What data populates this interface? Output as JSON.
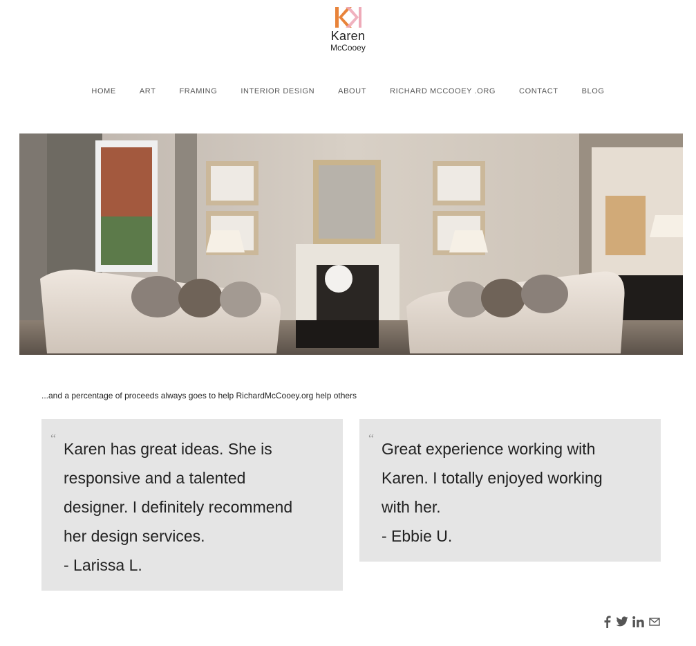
{
  "brand": {
    "name": "Karen",
    "subname": "McCooey",
    "colors": {
      "orange": "#e8833a",
      "pink": "#eeaab8"
    }
  },
  "nav": {
    "items": [
      {
        "label": "HOME"
      },
      {
        "label": "ART"
      },
      {
        "label": "FRAMING"
      },
      {
        "label": "INTERIOR DESIGN"
      },
      {
        "label": "ABOUT"
      },
      {
        "label": "RICHARD MCCOOEY .ORG"
      },
      {
        "label": "CONTACT"
      },
      {
        "label": "BLOG"
      }
    ]
  },
  "hero": {
    "image": "living-room-interior-photo"
  },
  "tagline": "...and a percentage of proceeds always goes to help RichardMcCooey.org help others",
  "testimonials": [
    {
      "text": "Karen has great ideas. She is\nresponsive and a talented\ndesigner. I definitely recommend\nher design services.\n- Larissa L."
    },
    {
      "text": "Great experience working with\nKaren. I totally enjoyed working\nwith her.\n- Ebbie U."
    }
  ],
  "social": {
    "icons": [
      "facebook-icon",
      "twitter-icon",
      "linkedin-icon",
      "mail-icon"
    ]
  }
}
